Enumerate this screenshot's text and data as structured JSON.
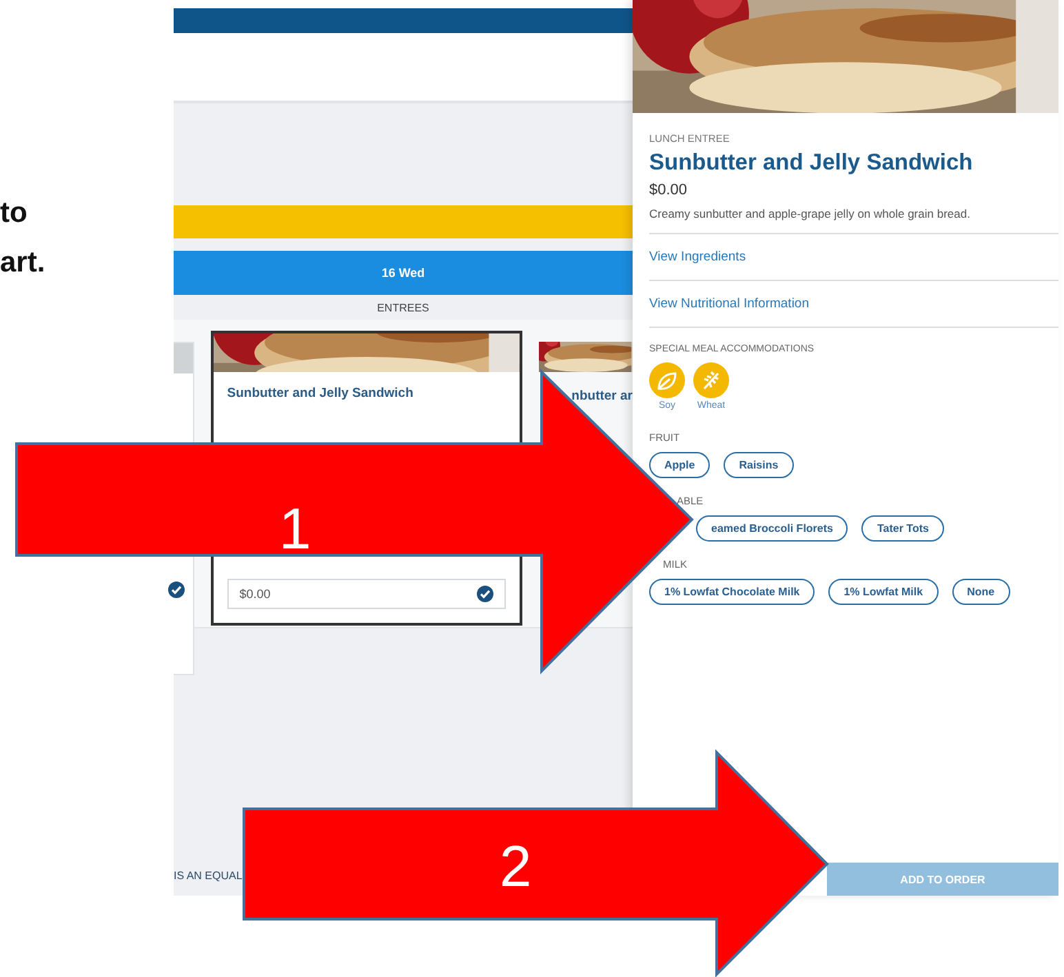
{
  "caption_fragments": [
    "to",
    "art."
  ],
  "date_bar": {
    "label": "16 Wed"
  },
  "section_heading": "ENTREES",
  "menu_cards": [
    {
      "title": "Sunbutter and Jelly Sandwich",
      "price": "$0.00",
      "selected": true
    },
    {
      "title": "nbutter ar",
      "selected": false
    }
  ],
  "footer_text": "IS AN EQUAL",
  "detail": {
    "category": "LUNCH ENTREE",
    "title": "Sunbutter and Jelly Sandwich",
    "price": "$0.00",
    "description": "Creamy sunbutter and apple-grape jelly on whole grain bread.",
    "links": [
      "View Ingredients",
      "View Nutritional Information"
    ],
    "accommodations_heading": "SPECIAL MEAL ACCOMMODATIONS",
    "accommodations": [
      {
        "label": "Soy",
        "kind": "leaf"
      },
      {
        "label": "Wheat",
        "kind": "wheat"
      }
    ],
    "option_groups": [
      {
        "heading": "FRUIT",
        "options": [
          "Apple",
          "Raisins"
        ]
      },
      {
        "heading": "ABLE",
        "options": [
          "eamed Broccoli Florets",
          "Tater Tots"
        ]
      },
      {
        "heading": "MILK",
        "options": [
          "1% Lowfat Chocolate Milk",
          "1% Lowfat Milk",
          "None"
        ]
      }
    ],
    "add_button": "ADD TO ORDER"
  },
  "annotations": [
    {
      "label": "1"
    },
    {
      "label": "2"
    }
  ]
}
